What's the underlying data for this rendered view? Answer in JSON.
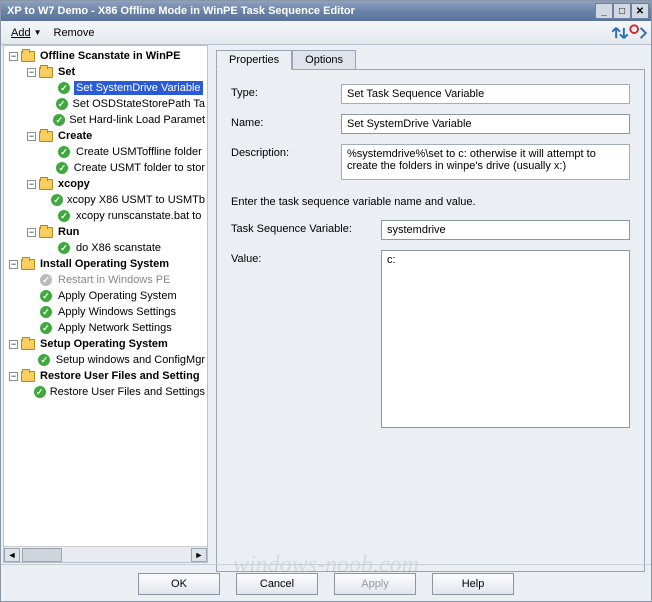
{
  "window": {
    "title": "XP to W7 Demo - X86 Offline Mode in WinPE Task Sequence Editor"
  },
  "toolbar": {
    "add_label": "Add",
    "remove_label": "Remove"
  },
  "tree": {
    "nodes": [
      {
        "depth": 0,
        "kind": "group-open",
        "label": "Offline Scanstate in WinPE",
        "bold": true
      },
      {
        "depth": 1,
        "kind": "group-open",
        "label": "Set",
        "bold": true
      },
      {
        "depth": 2,
        "kind": "step",
        "label": "Set SystemDrive Variable",
        "selected": true
      },
      {
        "depth": 2,
        "kind": "step",
        "label": "Set OSDStateStorePath Ta"
      },
      {
        "depth": 2,
        "kind": "step",
        "label": "Set Hard-link Load Paramet"
      },
      {
        "depth": 1,
        "kind": "group-open",
        "label": "Create",
        "bold": true
      },
      {
        "depth": 2,
        "kind": "step",
        "label": "Create USMToffline folder"
      },
      {
        "depth": 2,
        "kind": "step",
        "label": "Create USMT folder to stor"
      },
      {
        "depth": 1,
        "kind": "group-open",
        "label": "xcopy",
        "bold": true
      },
      {
        "depth": 2,
        "kind": "step",
        "label": "xcopy X86 USMT to USMTb"
      },
      {
        "depth": 2,
        "kind": "step",
        "label": "xcopy runscanstate.bat to"
      },
      {
        "depth": 1,
        "kind": "group-open",
        "label": "Run",
        "bold": true
      },
      {
        "depth": 2,
        "kind": "step",
        "label": "do X86 scanstate"
      },
      {
        "depth": 0,
        "kind": "group-open",
        "label": "Install Operating System",
        "bold": true
      },
      {
        "depth": 1,
        "kind": "step-disabled",
        "label": "Restart in Windows PE"
      },
      {
        "depth": 1,
        "kind": "step",
        "label": "Apply Operating System"
      },
      {
        "depth": 1,
        "kind": "step",
        "label": "Apply Windows Settings"
      },
      {
        "depth": 1,
        "kind": "step",
        "label": "Apply Network Settings"
      },
      {
        "depth": 0,
        "kind": "group-open",
        "label": "Setup Operating System",
        "bold": true
      },
      {
        "depth": 1,
        "kind": "step",
        "label": "Setup windows and ConfigMgr"
      },
      {
        "depth": 0,
        "kind": "group-open",
        "label": "Restore User Files and Setting",
        "bold": true
      },
      {
        "depth": 1,
        "kind": "step",
        "label": "Restore User Files and Settings"
      }
    ]
  },
  "tabs": {
    "properties": "Properties",
    "options": "Options",
    "active": "properties"
  },
  "form": {
    "type_label": "Type:",
    "type_value": "Set Task Sequence Variable",
    "name_label": "Name:",
    "name_value": "Set SystemDrive Variable",
    "desc_label": "Description:",
    "desc_value": "%systemdrive%\\set to c: otherwise it will attempt to create the folders in winpe's drive (usually x:)",
    "instruction": "Enter the task sequence variable name and value.",
    "var_label": "Task Sequence Variable:",
    "var_value": "systemdrive",
    "val_label": "Value:",
    "val_value": "c:"
  },
  "buttons": {
    "ok": "OK",
    "cancel": "Cancel",
    "apply": "Apply",
    "help": "Help"
  },
  "watermark": "windows-noob.com"
}
